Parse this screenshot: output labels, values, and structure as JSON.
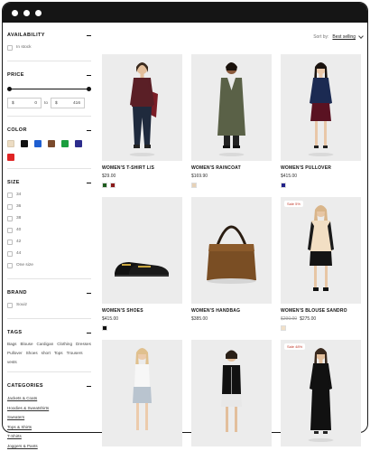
{
  "filters": {
    "availability": {
      "title": "AVAILABILITY",
      "option": "In stock"
    },
    "price": {
      "title": "PRICE",
      "currency": "$",
      "min": "0",
      "to": "to",
      "max": "416"
    },
    "color": {
      "title": "COLOR",
      "colors": [
        "#ecdcc3",
        "#111111",
        "#1f5fd1",
        "#7a4a2c",
        "#1b9e3e",
        "#2c2c8c",
        "#e02424"
      ]
    },
    "size": {
      "title": "SIZE",
      "options": [
        "34",
        "36",
        "38",
        "40",
        "42",
        "44",
        "One size"
      ]
    },
    "brand": {
      "title": "BRAND",
      "option": "Souiz"
    },
    "tags": {
      "title": "TAGS",
      "items": [
        "Bags",
        "Blouse",
        "Cardigan",
        "Clothing",
        "Dresses",
        "Pullover",
        "Shoes",
        "short",
        "Tops",
        "Trousers",
        "vests"
      ]
    },
    "categories": {
      "title": "CATEGORIES",
      "items": [
        "Jackets & Coats",
        "Hoodies & Sweatshirts",
        "Sweaters",
        "Tops & Shirts",
        "T-Shirts",
        "Joggers & Pants"
      ]
    }
  },
  "sort": {
    "label": "Sort by:",
    "value": "Best selling"
  },
  "products": [
    {
      "name": "WOMEN'S T-SHIRT L/S",
      "price": "$29.00",
      "old_price": "",
      "badge": "",
      "swatches": [
        "#1e5c1e",
        "#8b1a1a"
      ],
      "image": "woman-burgundy-top"
    },
    {
      "name": "WOMEN'S RAINCOAT",
      "price": "$169.90",
      "old_price": "",
      "badge": "",
      "swatches": [
        "#e7d2b8"
      ],
      "image": "woman-olive-coat"
    },
    {
      "name": "WOMEN'S PULLOVER",
      "price": "$415.00",
      "old_price": "",
      "badge": "",
      "swatches": [
        "#22228a"
      ],
      "image": "woman-navy-pullover"
    },
    {
      "name": "WOMEN'S SHOES",
      "price": "$415.00",
      "old_price": "",
      "badge": "",
      "swatches": [
        "#111111"
      ],
      "image": "black-loafers"
    },
    {
      "name": "WOMEN'S HANDBAG",
      "price": "$385.00",
      "old_price": "",
      "badge": "",
      "swatches": [],
      "image": "brown-suede-handbag"
    },
    {
      "name": "WOMEN'S BLOUSE SANDRO",
      "price": "$275.00",
      "old_price": "$290.00",
      "badge": "Sale 5%",
      "swatches": [
        "#f1e0c8"
      ],
      "image": "woman-cream-vest"
    },
    {
      "name": "",
      "price": "",
      "old_price": "",
      "badge": "",
      "swatches": [],
      "image": "woman-white-top"
    },
    {
      "name": "",
      "price": "",
      "old_price": "",
      "badge": "",
      "swatches": [],
      "image": "woman-black-cardigan"
    },
    {
      "name": "",
      "price": "",
      "old_price": "",
      "badge": "Sale 48%",
      "swatches": [],
      "image": "woman-black-dress"
    }
  ]
}
